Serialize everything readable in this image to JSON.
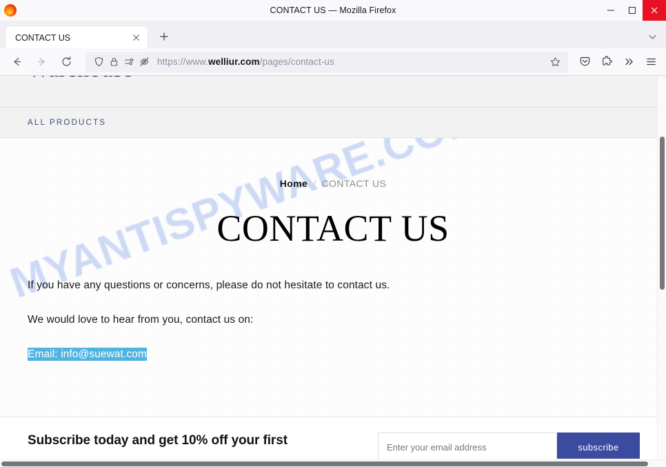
{
  "window": {
    "title": "CONTACT US — Mozilla Firefox",
    "minimize_label": "Minimize",
    "maximize_label": "Maximize",
    "close_label": "Close"
  },
  "tabs": {
    "items": [
      {
        "label": "CONTACT US",
        "active": true,
        "close_label": "Close tab"
      }
    ],
    "new_tab_label": "New tab",
    "list_all_tabs_label": "List all tabs"
  },
  "toolbar": {
    "back_label": "Go back one page",
    "forward_label": "Go forward one page",
    "reload_label": "Reload current page",
    "shield_label": "Enhanced Tracking Protection",
    "lock_label": "Connection secure",
    "permissions_label": "Site permissions",
    "blocked_autoplay_label": "Autoplay blocked",
    "bookmark_label": "Bookmark this page",
    "pocket_label": "Save to Pocket",
    "extensions_label": "Extensions",
    "overflow_label": "More tools",
    "menu_label": "Open application menu"
  },
  "url": {
    "scheme": "https://www.",
    "host": "welliur.com",
    "path": "/pages/contact-us",
    "full": "https://www.welliur.com/pages/contact-us"
  },
  "site": {
    "logo": "Warehouse",
    "nav": [
      {
        "label": "ALL PRODUCTS"
      }
    ]
  },
  "page": {
    "breadcrumb": {
      "home": "Home",
      "separator": "/",
      "current": "CONTACT US"
    },
    "title": "CONTACT US",
    "paragraphs": [
      "If you have any questions or concerns, please do not hesitate to contact us.",
      "We would love to hear from you, contact us on:"
    ],
    "email_line": "Email: info@suewat.com",
    "email_selected": true
  },
  "footer": {
    "heading": "Subscribe today and get 10% off your first",
    "email_placeholder": "Enter your email address",
    "email_value": "",
    "subscribe_label": "subscribe"
  },
  "watermark": {
    "text": "MYANTISPYWARE.COM"
  },
  "colors": {
    "selection_highlight": "#4fb3e0",
    "selection_text": "#ffffff",
    "site_logo": "#2f3a66",
    "nav_link": "#3c4a7a",
    "subscribe_button": "#3b4ba0",
    "watermark": "#ccd9f5",
    "close_button": "#e81123"
  }
}
